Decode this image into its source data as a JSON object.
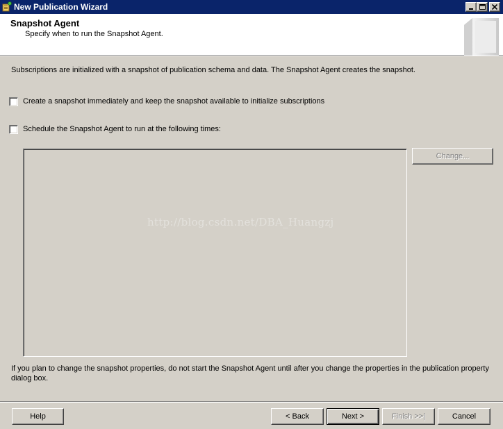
{
  "window": {
    "title": "New Publication Wizard",
    "icon": "wizard-icon"
  },
  "header": {
    "title": "Snapshot Agent",
    "subtitle": "Specify when to run the Snapshot Agent."
  },
  "description": "Subscriptions are initialized with a snapshot of publication schema and data. The Snapshot Agent creates the snapshot.",
  "options": {
    "immediate": {
      "label": "Create a snapshot immediately and keep the snapshot available to initialize subscriptions",
      "checked": false
    },
    "schedule": {
      "label": "Schedule the Snapshot Agent to run at the following times:",
      "checked": false
    }
  },
  "schedule": {
    "change_label": "Change...",
    "change_enabled": false
  },
  "watermark": "http://blog.csdn.net/DBA_Huangzj",
  "note": "If you plan to change the snapshot properties, do not start the Snapshot Agent until after you change the properties in the publication property dialog box.",
  "buttons": {
    "help": "Help",
    "back": "< Back",
    "next": "Next >",
    "finish": "Finish >>|",
    "cancel": "Cancel"
  },
  "colors": {
    "titlebar": "#0a246a",
    "face": "#d4d0c8",
    "header_bg": "#ffffff"
  }
}
